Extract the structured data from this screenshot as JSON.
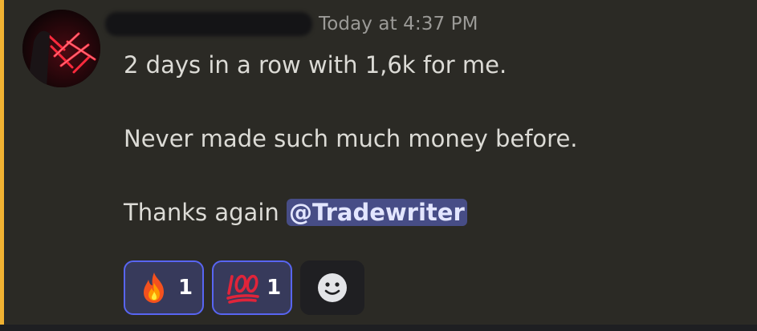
{
  "message": {
    "timestamp": "Today at 4:37 PM",
    "lines": [
      "2 days in a row with 1,6k for me.",
      "Never made such much money before.",
      "Thanks again "
    ],
    "mention": "@Tradewriter"
  },
  "reactions": [
    {
      "emoji": "fire-emoji",
      "count": "1"
    },
    {
      "emoji": "hundred-points-emoji",
      "count": "1"
    }
  ],
  "add_reaction": {
    "icon": "smiley-icon"
  },
  "colors": {
    "background": "#2b2a25",
    "highlight_bar": "#f0b232",
    "mention_bg": "#474d86",
    "reaction_border": "#5865f2",
    "reaction_bg": "#373a5b"
  }
}
